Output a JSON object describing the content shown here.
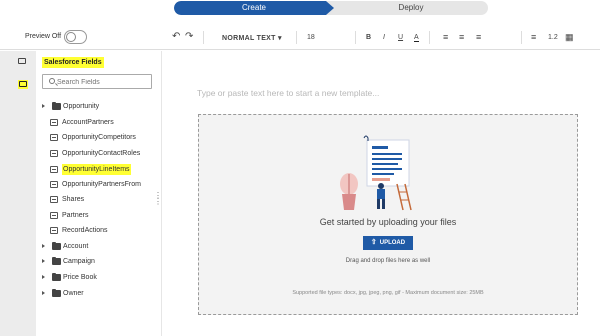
{
  "steps": {
    "create": "Create",
    "deploy": "Deploy"
  },
  "toolbar": {
    "preview_label": "Preview Off",
    "undo_icon": "undo-icon",
    "redo_icon": "redo-icon",
    "block_style": "NORMAL TEXT",
    "font_size": "18",
    "bold": "B",
    "italic": "I",
    "underline": "U",
    "font_color": "A",
    "list_number": "1.2"
  },
  "sidebar": {
    "title": "Salesforce Fields",
    "search_placeholder": "Search Fields",
    "items": [
      {
        "label": "Opportunity",
        "type": "folder"
      },
      {
        "label": "AccountPartners",
        "type": "relation"
      },
      {
        "label": "OpportunityCompetitors",
        "type": "relation"
      },
      {
        "label": "OpportunityContactRoles",
        "type": "relation"
      },
      {
        "label": "OpportunityLineItems",
        "type": "relation",
        "highlighted": true
      },
      {
        "label": "OpportunityPartnersFrom",
        "type": "relation"
      },
      {
        "label": "Shares",
        "type": "relation"
      },
      {
        "label": "Partners",
        "type": "relation"
      },
      {
        "label": "RecordActions",
        "type": "relation"
      },
      {
        "label": "Account",
        "type": "folder"
      },
      {
        "label": "Campaign",
        "type": "folder"
      },
      {
        "label": "Price Book",
        "type": "folder"
      },
      {
        "label": "Owner",
        "type": "folder"
      }
    ]
  },
  "editor": {
    "placeholder": "Type or paste text here to start a new template...",
    "dropzone_title": "Get started by uploading your files",
    "upload_label": "UPLOAD",
    "drag_hint": "Drag and drop files here as well",
    "supported": "Supported file types: docx, jpg, jpeg, png, gif - Maximum document size: 25MB"
  },
  "colors": {
    "accent": "#1f5aa6",
    "highlight": "#ffff33"
  }
}
